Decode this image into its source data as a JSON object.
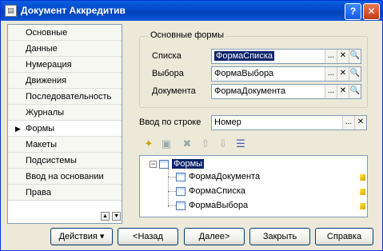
{
  "window": {
    "title": "Документ Аккредитив",
    "help_label": "?",
    "close_label": "✕"
  },
  "tabs": [
    {
      "label": "Основные",
      "active": false
    },
    {
      "label": "Данные",
      "active": false
    },
    {
      "label": "Нумерация",
      "active": false
    },
    {
      "label": "Движения",
      "active": false
    },
    {
      "label": "Последовательность",
      "active": false
    },
    {
      "label": "Журналы",
      "active": false
    },
    {
      "label": "Формы",
      "active": true
    },
    {
      "label": "Макеты",
      "active": false
    },
    {
      "label": "Подсистемы",
      "active": false
    },
    {
      "label": "Ввод на основании",
      "active": false
    },
    {
      "label": "Права",
      "active": false
    }
  ],
  "main_forms": {
    "group_title": "Основные формы",
    "list_label": "Списка",
    "list_value": "ФормаСписка",
    "choice_label": "Выбора",
    "choice_value": "ФормаВыбора",
    "doc_label": "Документа",
    "doc_value": "ФормаДокумента"
  },
  "input_by_string": {
    "label": "Ввод по строке",
    "value": "Номер"
  },
  "field_buttons": {
    "select": "...",
    "clear": "✕",
    "open": "🔍"
  },
  "tree": {
    "root": "Формы",
    "children": [
      "ФормаДокумента",
      "ФормаСписка",
      "ФормаВыбора"
    ]
  },
  "buttons": {
    "actions": "Действия",
    "actions_arrow": "▾",
    "back": "<Назад",
    "next": "Далее>",
    "close": "Закрыть",
    "help": "Справка"
  },
  "icons": {
    "tab_pointer": "▶",
    "scroll_up": "▲",
    "scroll_down": "▼"
  }
}
